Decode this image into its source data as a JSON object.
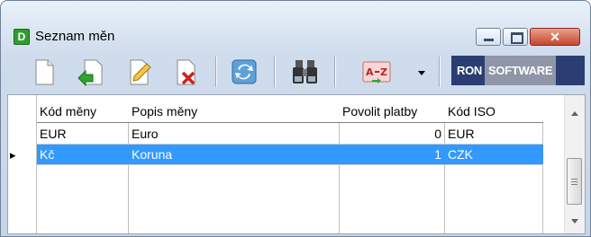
{
  "window": {
    "title": "Seznam měn",
    "app_icon_letter": "D",
    "close_glyph": "✕"
  },
  "toolbar": {
    "icons": [
      "new-document-icon",
      "open-export-icon",
      "edit-icon",
      "delete-icon",
      "refresh-icon",
      "binoculars-find-icon",
      "sort-az-icon",
      "dropdown-arrow-icon"
    ]
  },
  "brand": {
    "ron": "RON",
    "software": "SOFTWARE"
  },
  "table": {
    "columns": [
      "Kód měny",
      "Popis měny",
      "Povolit platby",
      "Kód ISO"
    ],
    "rows": [
      {
        "kod": "EUR",
        "popis": "Euro",
        "povolit": "0",
        "iso": "EUR",
        "selected": false
      },
      {
        "kod": "Kč",
        "popis": "Koruna",
        "povolit": "1",
        "iso": "CZK",
        "selected": true
      }
    ],
    "row_indicator": "▸"
  },
  "colors": {
    "selection": "#3399ff",
    "brand_bg": "#2c3d73"
  }
}
